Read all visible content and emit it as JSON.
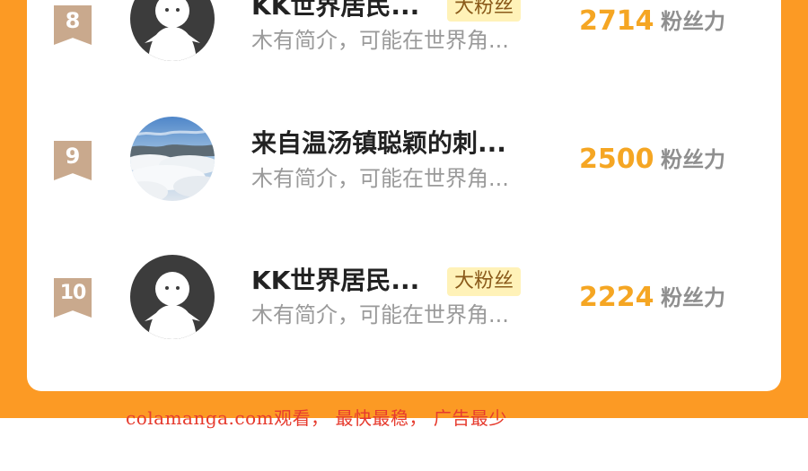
{
  "ranking": {
    "rows": [
      {
        "rank": "8",
        "avatar": "default-avatar",
        "name": "KK世界居民...",
        "badge": "大粉丝",
        "intro": "木有简介，可能在世界角...",
        "score": "2714",
        "score_label": "粉丝力"
      },
      {
        "rank": "9",
        "avatar": "cloud-landscape-photo",
        "name": "来自温汤镇聪颖的刺...",
        "badge": "",
        "intro": "木有简介，可能在世界角...",
        "score": "2500",
        "score_label": "粉丝力"
      },
      {
        "rank": "10",
        "avatar": "default-avatar",
        "name": "KK世界居民...",
        "badge": "大粉丝",
        "intro": "木有简介，可能在世界角...",
        "score": "2224",
        "score_label": "粉丝力"
      }
    ]
  },
  "watermark": "colamanga.com观看， 最快最稳， 广告最少",
  "colors": {
    "background_accent": "#fc9a24",
    "rank_ribbon": "#c9a98d",
    "score": "#f5a623",
    "badge_bg": "#fff2b8",
    "watermark": "#e63b2e"
  }
}
